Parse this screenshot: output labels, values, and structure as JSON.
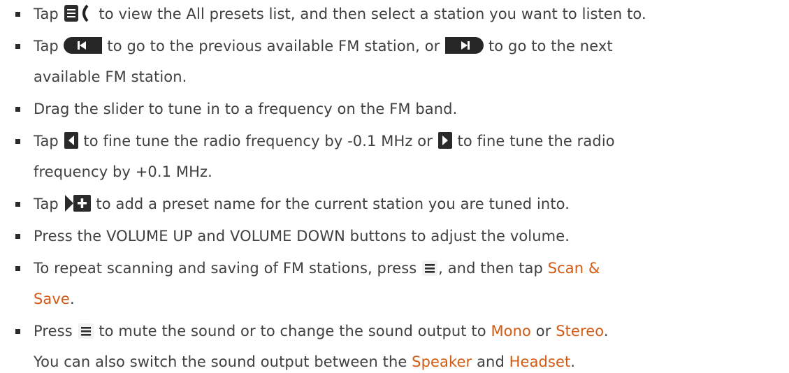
{
  "items": [
    {
      "lines": [
        {
          "parts": [
            {
              "t": "Tap "
            },
            {
              "icon": "presets-list-icon"
            },
            {
              "t": " to view the All presets list, and then select a station you want to listen to."
            }
          ]
        }
      ]
    },
    {
      "lines": [
        {
          "parts": [
            {
              "t": "Tap "
            },
            {
              "icon": "previous-station-icon"
            },
            {
              "t": " to go to the previous available FM station, or "
            },
            {
              "icon": "next-station-icon"
            },
            {
              "t": " to go to the next"
            }
          ]
        },
        {
          "parts": [
            {
              "t": "available FM station."
            }
          ]
        }
      ]
    },
    {
      "lines": [
        {
          "parts": [
            {
              "t": "Drag the slider to tune in to a frequency on the FM band."
            }
          ]
        }
      ]
    },
    {
      "lines": [
        {
          "parts": [
            {
              "t": "Tap "
            },
            {
              "icon": "tune-down-icon"
            },
            {
              "t": " to fine tune the radio frequency by -0.1 MHz or "
            },
            {
              "icon": "tune-up-icon"
            },
            {
              "t": " to fine tune the radio"
            }
          ]
        },
        {
          "parts": [
            {
              "t": "frequency by +0.1 MHz."
            }
          ]
        }
      ]
    },
    {
      "lines": [
        {
          "parts": [
            {
              "t": "Tap "
            },
            {
              "icon": "add-preset-icon"
            },
            {
              "t": " to add a preset name for the current station you are tuned into."
            }
          ]
        }
      ]
    },
    {
      "lines": [
        {
          "parts": [
            {
              "t": "Press the VOLUME UP and VOLUME DOWN buttons to adjust the volume."
            }
          ]
        }
      ]
    },
    {
      "lines": [
        {
          "parts": [
            {
              "t": "To repeat scanning and saving of FM stations, press "
            },
            {
              "icon": "menu-icon"
            },
            {
              "t": ", and then tap "
            },
            {
              "t": "Scan &",
              "hl": true
            }
          ]
        },
        {
          "parts": [
            {
              "t": "Save",
              "hl": true
            },
            {
              "t": "."
            }
          ]
        }
      ]
    },
    {
      "lines": [
        {
          "parts": [
            {
              "t": "Press "
            },
            {
              "icon": "menu-icon"
            },
            {
              "t": " to mute the sound or to change the sound output to "
            },
            {
              "t": "Mono",
              "hl": true
            },
            {
              "t": " or "
            },
            {
              "t": "Stereo",
              "hl": true
            },
            {
              "t": "."
            }
          ]
        },
        {
          "parts": [
            {
              "t": "You can also switch the sound output between the "
            },
            {
              "t": "Speaker",
              "hl": true
            },
            {
              "t": " and "
            },
            {
              "t": "Headset",
              "hl": true
            },
            {
              "t": "."
            }
          ]
        }
      ]
    }
  ]
}
